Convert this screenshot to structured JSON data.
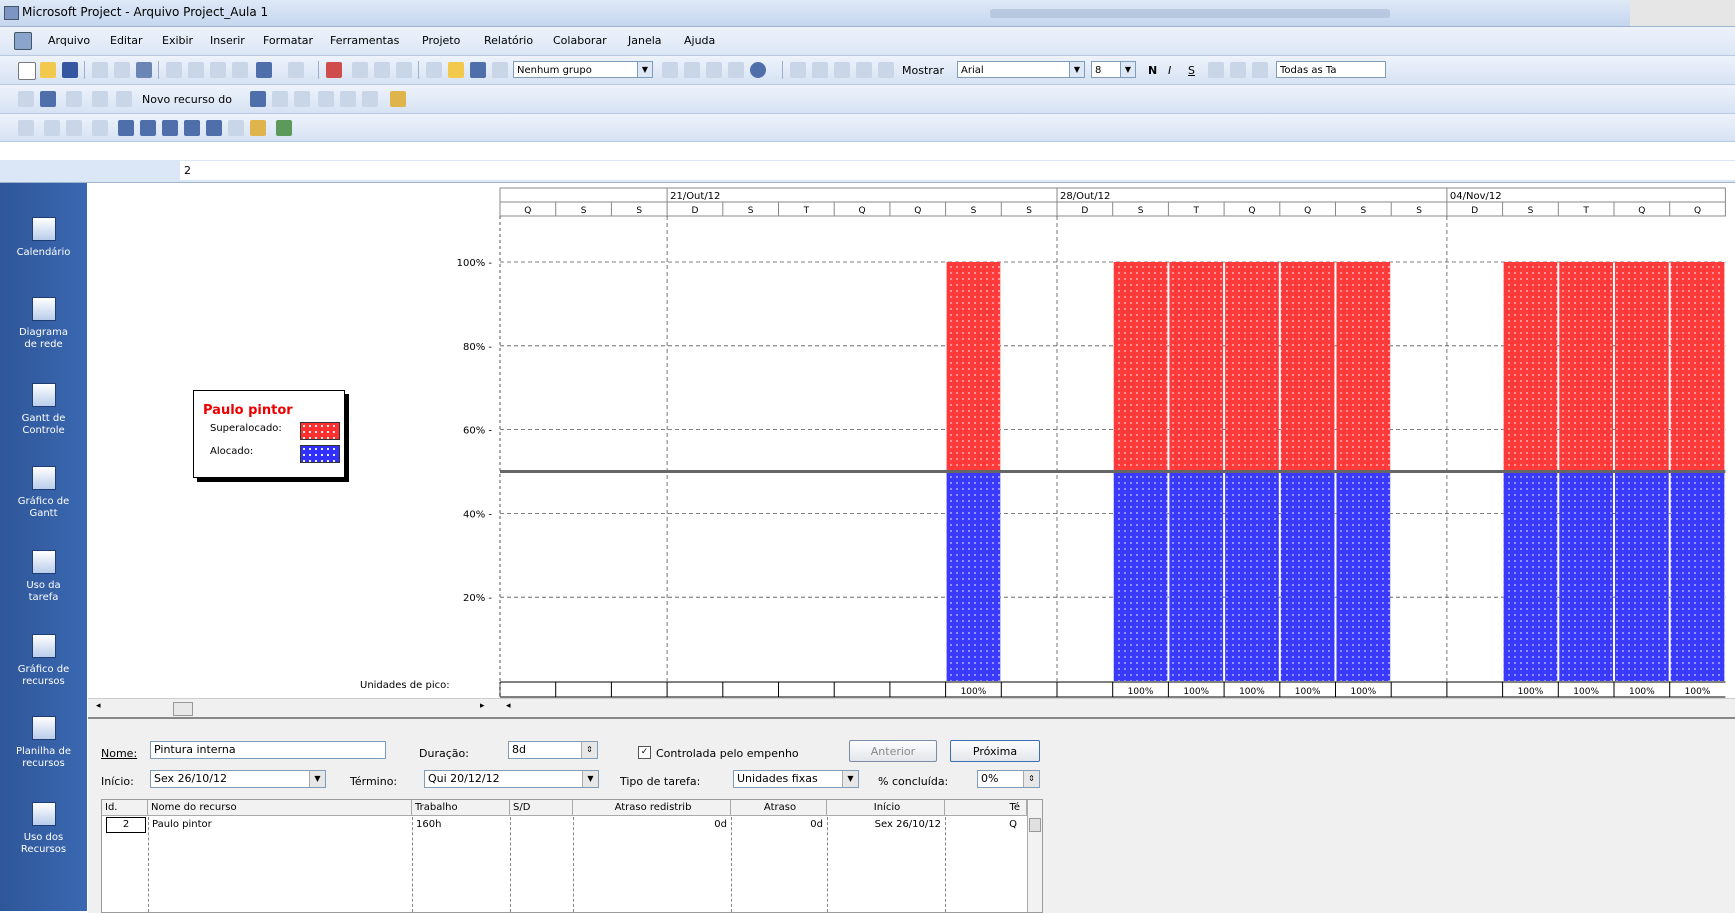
{
  "window": {
    "title": "Microsoft Project - Arquivo Project_Aula 1"
  },
  "menu": [
    "Arquivo",
    "Editar",
    "Exibir",
    "Inserir",
    "Formatar",
    "Ferramentas",
    "Projeto",
    "Relatório",
    "Colaborar",
    "Janela",
    "Ajuda"
  ],
  "toolbar": {
    "group_combo": "Nenhum grupo",
    "show_button": "Mostrar",
    "font_combo": "Arial",
    "size_combo": "8",
    "bold": "N",
    "italic": "I",
    "underline": "S",
    "filter_combo": "Todas as Ta",
    "new_resource": "Novo recurso do"
  },
  "entry_bar": {
    "value": "2"
  },
  "view_bar": [
    {
      "label": "Calendário",
      "icon": "calendar-icon"
    },
    {
      "label": "Diagrama de rede",
      "icon": "network-diagram-icon"
    },
    {
      "label": "Gantt de Controle",
      "icon": "tracking-gantt-icon"
    },
    {
      "label": "Gráfico de Gantt",
      "icon": "gantt-chart-icon"
    },
    {
      "label": "Uso da tarefa",
      "icon": "task-usage-icon"
    },
    {
      "label": "Gráfico de recursos",
      "icon": "resource-graph-icon"
    },
    {
      "label": "Planilha de recursos",
      "icon": "resource-sheet-icon"
    },
    {
      "label": "Uso dos Recursos",
      "icon": "resource-usage-icon"
    }
  ],
  "colors": {
    "overallocated": "#ff0000",
    "allocated": "#0000ff",
    "viewbar": "#3a68b1"
  },
  "chart_data": {
    "type": "bar",
    "resource": "Paulo pintor",
    "legend": [
      {
        "label": "Superalocado:",
        "color": "#ff0000"
      },
      {
        "label": "Alocado:",
        "color": "#0000ff"
      }
    ],
    "week_labels": [
      "21/Out/12",
      "28/Out/12",
      "04/Nov/12"
    ],
    "day_labels": [
      "Q",
      "S",
      "S",
      "D",
      "S",
      "T",
      "Q",
      "Q",
      "S",
      "S",
      "D",
      "S",
      "T",
      "Q",
      "Q",
      "S",
      "S",
      "D",
      "S",
      "T",
      "Q",
      "Q"
    ],
    "week_starts": [
      3,
      10,
      17
    ],
    "yticks": [
      "100%",
      "80%",
      "60%",
      "40%",
      "20%"
    ],
    "ylim": [
      0,
      100
    ],
    "max_units_line": 50,
    "allocated": [
      0,
      0,
      0,
      0,
      0,
      0,
      0,
      0,
      50,
      0,
      0,
      50,
      50,
      50,
      50,
      50,
      0,
      0,
      50,
      50,
      50,
      50
    ],
    "overallocated": [
      0,
      0,
      0,
      0,
      0,
      0,
      0,
      0,
      50,
      0,
      0,
      50,
      50,
      50,
      50,
      50,
      0,
      0,
      50,
      50,
      50,
      50
    ],
    "peak_label": "Unidades de pico:",
    "peak_units": [
      "",
      "",
      "",
      "",
      "",
      "",
      "",
      "",
      "100%",
      "",
      "",
      "100%",
      "100%",
      "100%",
      "100%",
      "100%",
      "",
      "",
      "100%",
      "100%",
      "100%",
      "100%"
    ]
  },
  "form": {
    "name_label": "Nome:",
    "name_value": "Pintura interna",
    "duration_label": "Duração:",
    "duration_value": "8d",
    "effort_driven_label": "Controlada pelo empenho",
    "prev_button": "Anterior",
    "next_button": "Próxima",
    "start_label": "Início:",
    "start_value": "Sex 26/10/12",
    "finish_label": "Término:",
    "finish_value": "Qui 20/12/12",
    "task_type_label": "Tipo de tarefa:",
    "task_type_value": "Unidades fixas",
    "pct_label": "% concluída:",
    "pct_value": "0%",
    "table": {
      "headers": [
        "Id.",
        "Nome do recurso",
        "Trabalho",
        "S/D",
        "Atraso redistrib",
        "Atraso",
        "Início",
        "Té"
      ],
      "rows": [
        [
          "2",
          "Paulo pintor",
          "160h",
          "",
          "0d",
          "0d",
          "Sex 26/10/12",
          "Q"
        ]
      ]
    }
  }
}
